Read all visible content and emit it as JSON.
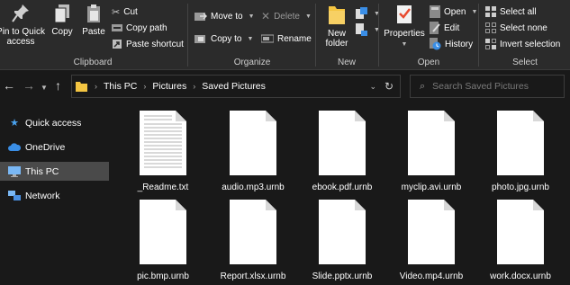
{
  "ribbon": {
    "clipboard": {
      "pin_label_1": "Pin to Quick",
      "pin_label_2": "access",
      "copy": "Copy",
      "paste": "Paste",
      "cut": "Cut",
      "copy_path": "Copy path",
      "paste_shortcut": "Paste shortcut",
      "group": "Clipboard"
    },
    "organize": {
      "move_to": "Move to",
      "copy_to": "Copy to",
      "delete": "Delete",
      "rename": "Rename",
      "group": "Organize"
    },
    "new": {
      "new_folder_1": "New",
      "new_folder_2": "folder",
      "group": "New"
    },
    "open": {
      "properties": "Properties",
      "open": "Open",
      "edit": "Edit",
      "history": "History",
      "group": "Open"
    },
    "select": {
      "select_all": "Select all",
      "select_none": "Select none",
      "invert_selection": "Invert selection",
      "group": "Select"
    }
  },
  "address": {
    "crumbs": [
      "This PC",
      "Pictures",
      "Saved Pictures"
    ],
    "search_placeholder": "Search Saved Pictures"
  },
  "nav": {
    "items": [
      {
        "label": "Quick access",
        "icon": "star-icon"
      },
      {
        "label": "OneDrive",
        "icon": "cloud-icon"
      },
      {
        "label": "This PC",
        "icon": "computer-icon",
        "selected": true
      },
      {
        "label": "Network",
        "icon": "network-icon"
      }
    ]
  },
  "files": [
    {
      "name": "_Readme.txt",
      "lined": true
    },
    {
      "name": "audio.mp3.urnb"
    },
    {
      "name": "ebook.pdf.urnb"
    },
    {
      "name": "myclip.avi.urnb"
    },
    {
      "name": "photo.jpg.urnb"
    },
    {
      "name": "pic.bmp.urnb"
    },
    {
      "name": "Report.xlsx.urnb"
    },
    {
      "name": "Slide.pptx.urnb"
    },
    {
      "name": "Video.mp4.urnb"
    },
    {
      "name": "work.docx.urnb"
    }
  ],
  "colors": {
    "background": "#191919",
    "ribbon": "#2b2b2b",
    "selected": "#4a4a4a",
    "accent_blue": "#3a8ee6",
    "folder_yellow": "#f4c542"
  }
}
